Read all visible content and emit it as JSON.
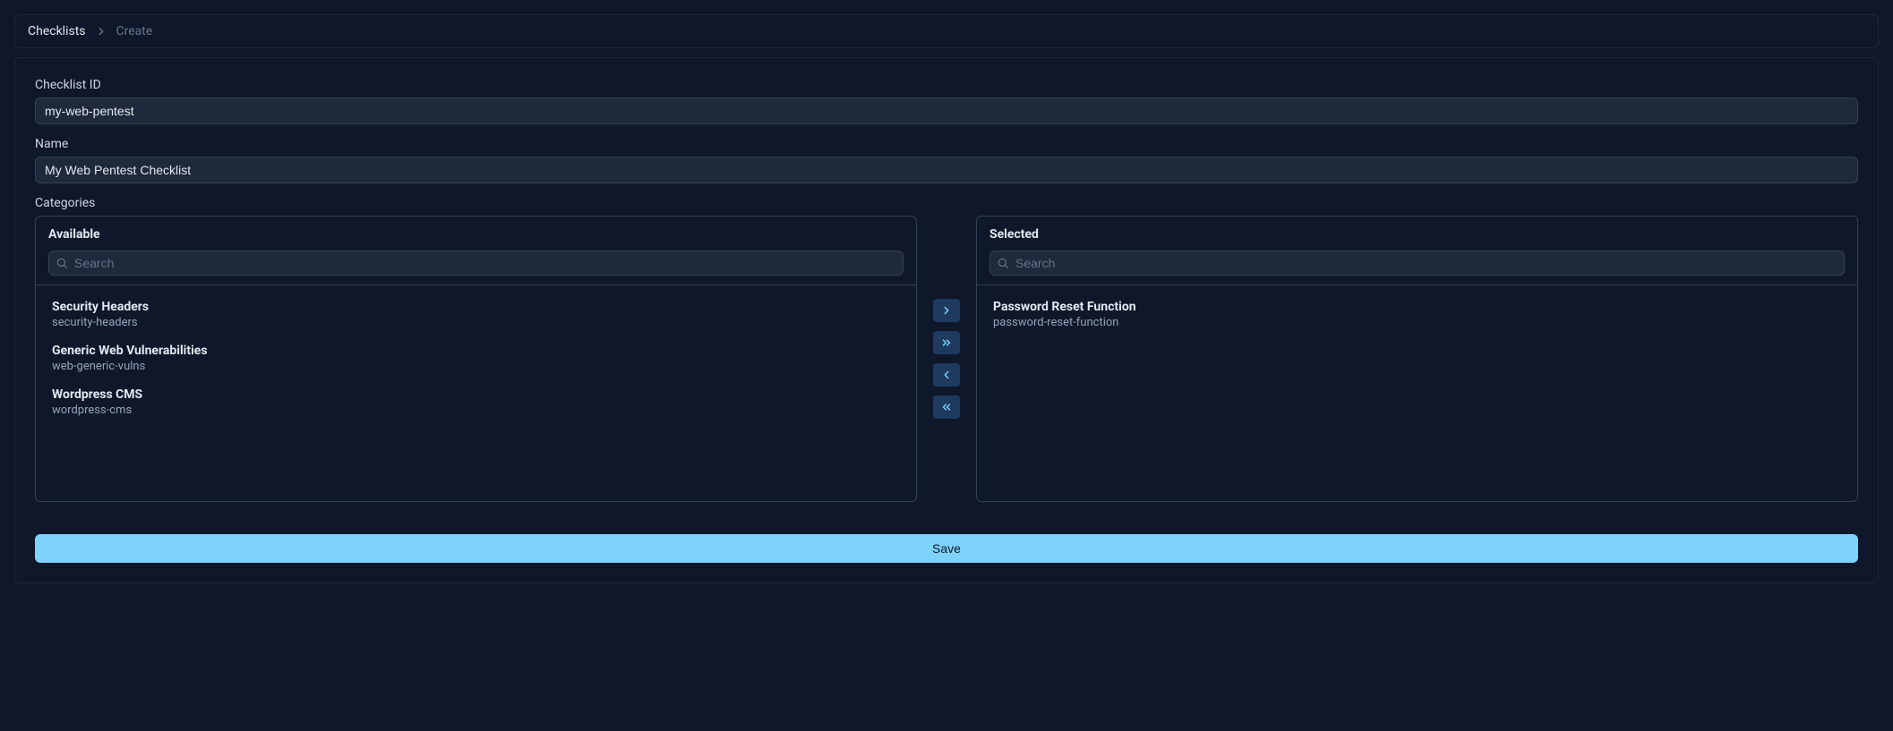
{
  "breadcrumb": {
    "root": "Checklists",
    "current": "Create"
  },
  "form": {
    "checklist_id_label": "Checklist ID",
    "checklist_id_value": "my-web-pentest",
    "name_label": "Name",
    "name_value": "My Web Pentest Checklist",
    "categories_label": "Categories"
  },
  "dual_list": {
    "available_title": "Available",
    "selected_title": "Selected",
    "search_placeholder": "Search",
    "available": [
      {
        "title": "Security Headers",
        "id": "security-headers"
      },
      {
        "title": "Generic Web Vulnerabilities",
        "id": "web-generic-vulns"
      },
      {
        "title": "Wordpress CMS",
        "id": "wordpress-cms"
      }
    ],
    "selected": [
      {
        "title": "Password Reset Function",
        "id": "password-reset-function"
      }
    ]
  },
  "save_label": "Save"
}
